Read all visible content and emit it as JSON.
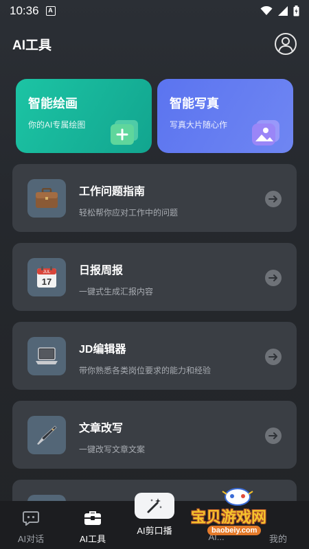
{
  "status_bar": {
    "time": "10:36",
    "notif_letter": "A"
  },
  "header": {
    "title": "AI工具"
  },
  "hero": [
    {
      "title": "智能绘画",
      "subtitle": "你的AI专属绘图",
      "icon": "add-image-icon"
    },
    {
      "title": "智能写真",
      "subtitle": "写真大片随心作",
      "icon": "portrait-icon"
    }
  ],
  "tools": [
    {
      "title": "工作问题指南",
      "subtitle": "轻松帮你应对工作中的问题",
      "icon": "briefcase-icon"
    },
    {
      "title": "日报周报",
      "subtitle": "一键式生成汇报内容",
      "icon": "calendar-icon",
      "calendar_month": "JUL",
      "calendar_day": "17"
    },
    {
      "title": "JD编辑器",
      "subtitle": "带你熟悉各类岗位要求的能力和经验",
      "icon": "laptop-icon"
    },
    {
      "title": "文章改写",
      "subtitle": "一键改写文章文案",
      "icon": "pen-icon"
    }
  ],
  "tabs": [
    {
      "label": "AI对话",
      "icon": "chat-icon",
      "active": false
    },
    {
      "label": "AI工具",
      "icon": "toolbox-icon",
      "active": true
    },
    {
      "label": "AI剪口播",
      "icon": "magic-wand-icon",
      "active": false
    },
    {
      "label": "AI...",
      "icon": "",
      "active": false
    },
    {
      "label": "我的",
      "icon": "",
      "active": false
    }
  ],
  "watermark": {
    "text": "宝贝游戏网",
    "url": "baobeiy.com"
  },
  "colors": {
    "paint_card": "#16b59a",
    "photo_card": "#6680f1",
    "tool_card": "#3a3e44",
    "icon_tile": "#536677"
  }
}
